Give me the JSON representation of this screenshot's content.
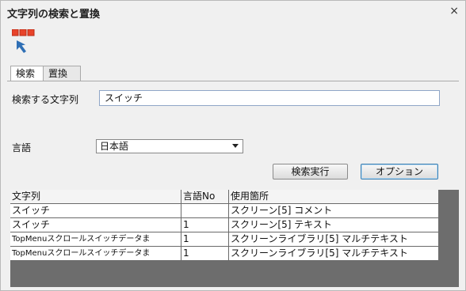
{
  "window": {
    "title": "文字列の検索と置換",
    "close_label": "×"
  },
  "tabs": [
    {
      "label": "検索",
      "active": true
    },
    {
      "label": "置換",
      "active": false
    }
  ],
  "search": {
    "label": "検索する文字列",
    "value": "スイッチ"
  },
  "language": {
    "label": "言語",
    "selected": "日本語"
  },
  "buttons": {
    "search": "検索実行",
    "options": "オプション"
  },
  "table": {
    "headers": [
      "文字列",
      "言語No",
      "使用箇所"
    ],
    "rows": [
      [
        "スイッチ",
        "",
        "スクリーン[5] コメント"
      ],
      [
        "スイッチ",
        "1",
        "スクリーン[5] テキスト"
      ],
      [
        "TopMenuスクロールスイッチデータま",
        "1",
        "スクリーンライブラリ[5] マルチテキスト"
      ],
      [
        "TopMenuスクロールスイッチデータま",
        "1",
        "スクリーンライブラリ[5] マルチテキスト"
      ]
    ]
  },
  "colors": {
    "icon_red": "#e8432a",
    "icon_blue": "#2f6fb5",
    "grid_bg": "#6d6d6d"
  },
  "icons": {
    "tool": "search-replace-tool-icon"
  }
}
